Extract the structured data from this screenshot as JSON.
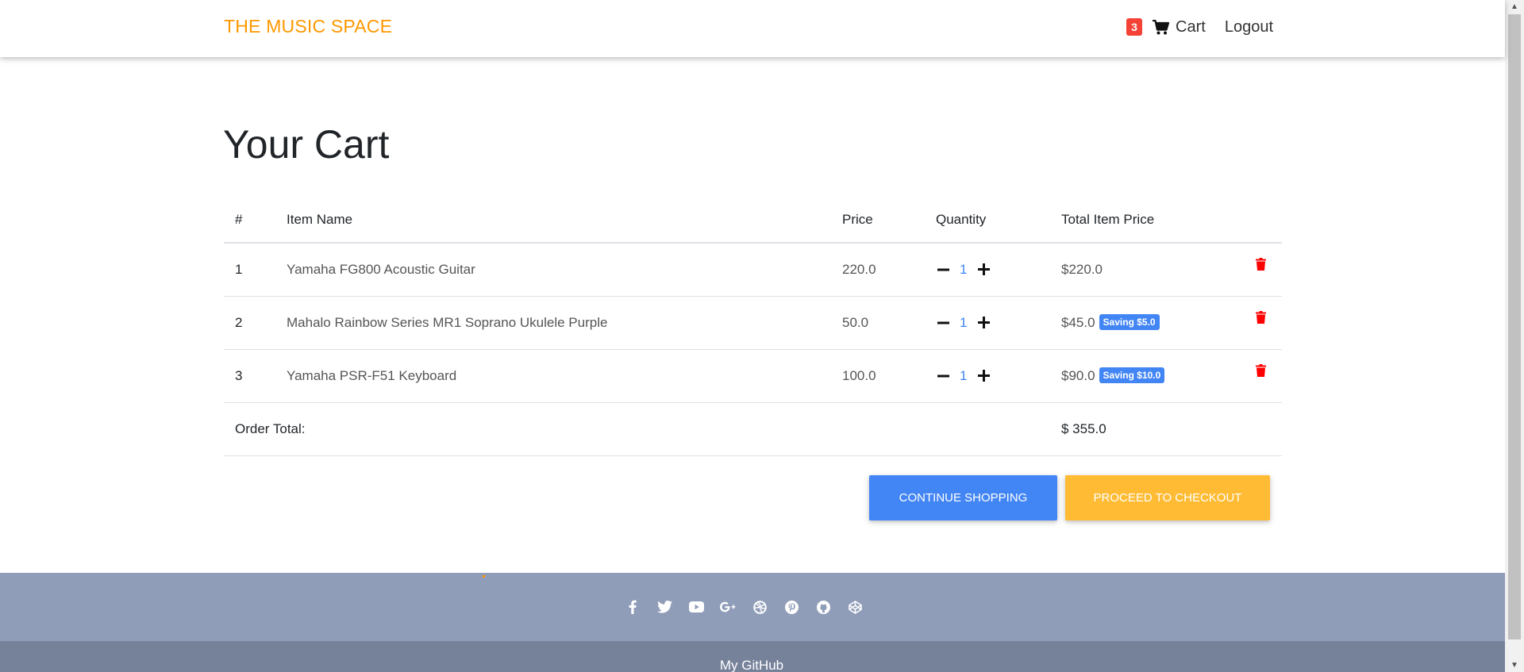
{
  "navbar": {
    "brand": "THE MUSIC SPACE",
    "cart_count": "3",
    "cart_label": "Cart",
    "logout_label": "Logout"
  },
  "page": {
    "title": "Your Cart"
  },
  "table": {
    "headers": [
      "#",
      "Item Name",
      "Price",
      "Quantity",
      "Total Item Price",
      ""
    ],
    "rows": [
      {
        "num": "1",
        "name": "Yamaha FG800 Acoustic Guitar",
        "price": "220.0",
        "qty": "1",
        "total": "$220.0",
        "saving": ""
      },
      {
        "num": "2",
        "name": "Mahalo Rainbow Series MR1 Soprano Ukulele Purple",
        "price": "50.0",
        "qty": "1",
        "total": "$45.0",
        "saving": "Saving $5.0"
      },
      {
        "num": "3",
        "name": "Yamaha PSR-F51 Keyboard",
        "price": "100.0",
        "qty": "1",
        "total": "$90.0",
        "saving": "Saving $10.0"
      }
    ],
    "order_total_label": "Order Total:",
    "order_total_value": "$ 355.0"
  },
  "actions": {
    "continue_label": "CONTINUE SHOPPING",
    "checkout_label": "PROCEED TO CHECKOUT"
  },
  "footer": {
    "social_icons": [
      "facebook-icon",
      "twitter-icon",
      "youtube-icon",
      "google-plus-icon",
      "dribbble-icon",
      "pinterest-icon",
      "github-icon",
      "codepen-icon"
    ],
    "link_label": "My GitHub"
  },
  "colors": {
    "brand": "#ff9800",
    "badge": "#f44336",
    "primary": "#4285f4",
    "warning": "#ffbb33",
    "danger": "#ff0000",
    "footer": "#8f9db9",
    "footer_bottom": "#76819a"
  }
}
